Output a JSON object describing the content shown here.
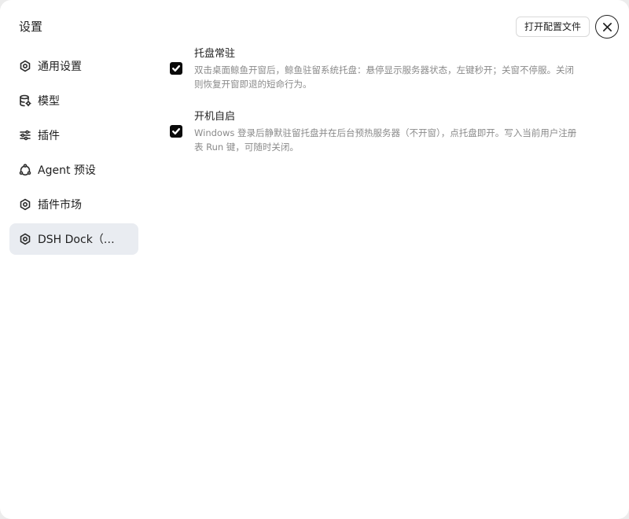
{
  "sidebar": {
    "title": "设置",
    "items": [
      {
        "label": "通用设置",
        "icon": "gear-icon",
        "active": false
      },
      {
        "label": "模型",
        "icon": "database-icon",
        "active": false
      },
      {
        "label": "插件",
        "icon": "sliders-icon",
        "active": false
      },
      {
        "label": "Agent 预设",
        "icon": "cycle-icon",
        "active": false
      },
      {
        "label": "插件市场",
        "icon": "gear-icon",
        "active": false
      },
      {
        "label": "DSH Dock（启...",
        "icon": "gear-icon",
        "active": true
      }
    ]
  },
  "header": {
    "open_config_label": "打开配置文件",
    "close_icon": "close-icon"
  },
  "settings": [
    {
      "title": "托盘常驻",
      "description": "双击桌面鲸鱼开窗后，鲸鱼驻留系统托盘：悬停显示服务器状态，左键秒开；关窗不停服。关闭则恢复开窗即退的短命行为。",
      "checked": true
    },
    {
      "title": "开机自启",
      "description": "Windows 登录后静默驻留托盘并在后台预热服务器（不开窗），点托盘即开。写入当前用户注册表 Run 键，可随时关闭。",
      "checked": true
    }
  ],
  "colors": {
    "active_nav_bg": "#e9ecf1",
    "checkbox": "#0a0a0a",
    "muted_text": "#8a8a8a"
  }
}
